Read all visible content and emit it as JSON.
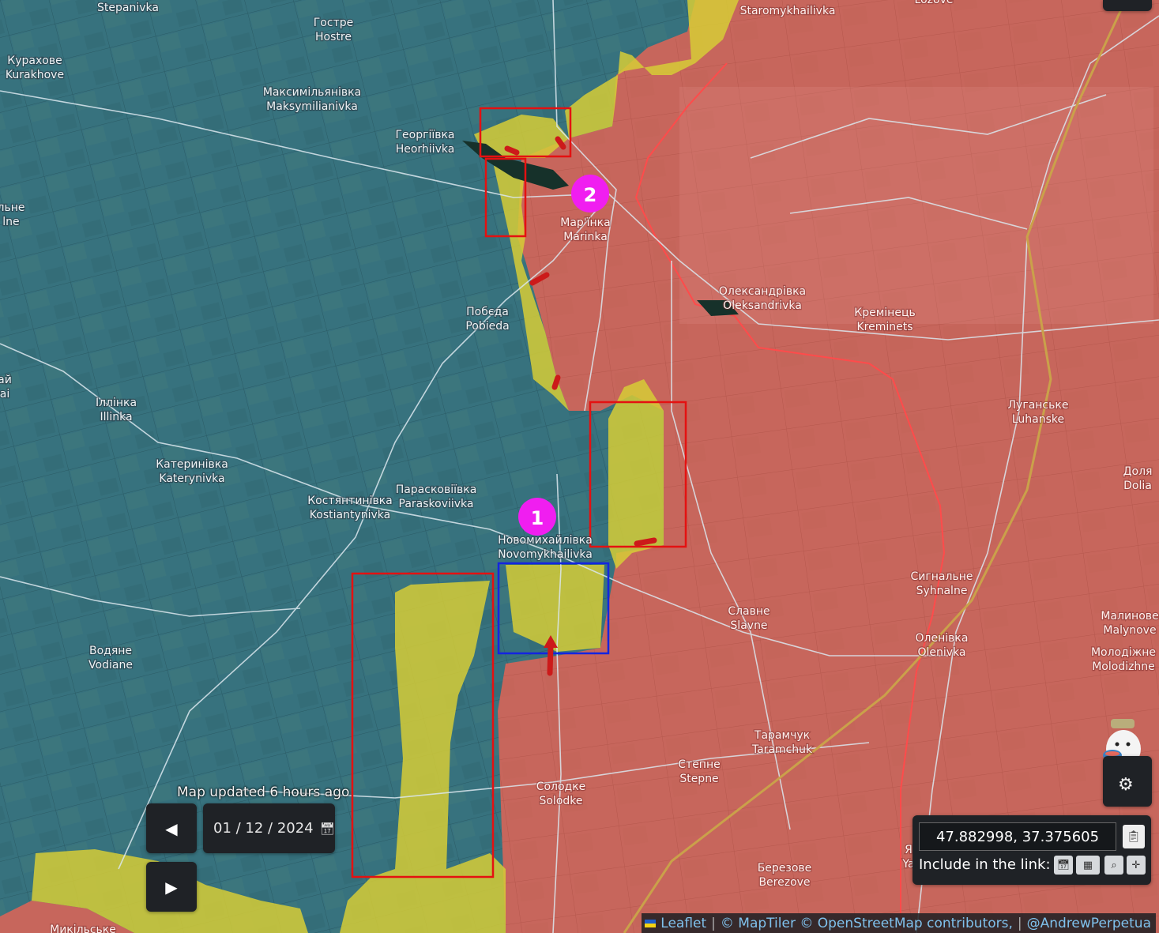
{
  "map": {
    "cities": [
      {
        "id": "stepanivka",
        "lines": [
          "Stepanivka"
        ]
      },
      {
        "id": "hostre",
        "lines": [
          "Гостре",
          "Hostre"
        ]
      },
      {
        "id": "kurakhove",
        "lines": [
          "Курахове",
          "Kurakhove"
        ]
      },
      {
        "id": "maksymilianivka",
        "lines": [
          "Максимільянівка",
          "Maksymilianivka"
        ]
      },
      {
        "id": "heorhiivka",
        "lines": [
          "Георгіївка",
          "Heorhiivka"
        ]
      },
      {
        "id": "marinka",
        "lines": [
          "Мар'їнка",
          "Marinka"
        ]
      },
      {
        "id": "pobieda",
        "lines": [
          "Побєда",
          "Pobieda"
        ]
      },
      {
        "id": "oleksandrivka",
        "lines": [
          "Олександрівка",
          "Oleksandrivka"
        ]
      },
      {
        "id": "kreminets",
        "lines": [
          "Кремінець",
          "Kreminets"
        ]
      },
      {
        "id": "illinka",
        "lines": [
          "Іллінка",
          "Illinka"
        ]
      },
      {
        "id": "katerynivka",
        "lines": [
          "Катеринівка",
          "Katerynivka"
        ]
      },
      {
        "id": "paraskoviivka",
        "lines": [
          "Парасковіївка",
          "Paraskoviivka"
        ]
      },
      {
        "id": "kostiantynivka",
        "lines": [
          "Костянтинівка",
          "Kostiantynivka"
        ]
      },
      {
        "id": "novomykhailivka",
        "lines": [
          "Новомихайлівка",
          "Novomykhailivka"
        ]
      },
      {
        "id": "luhanske",
        "lines": [
          "Луганське",
          "Luhanske"
        ]
      },
      {
        "id": "dolia",
        "lines": [
          "Доля",
          "Dolia"
        ]
      },
      {
        "id": "syhnalne",
        "lines": [
          "Сигнальне",
          "Syhnalne"
        ]
      },
      {
        "id": "slavne",
        "lines": [
          "Славне",
          "Slavne"
        ]
      },
      {
        "id": "vodiane",
        "lines": [
          "Водяне",
          "Vodiane"
        ]
      },
      {
        "id": "olenivka",
        "lines": [
          "Оленівка",
          "Olenivka"
        ]
      },
      {
        "id": "malynove",
        "lines": [
          "Малинове",
          "Malynove"
        ]
      },
      {
        "id": "molodizhne",
        "lines": [
          "Молодіжне",
          "Molodizhne"
        ]
      },
      {
        "id": "taramchuk",
        "lines": [
          "Тарамчук",
          "Taramchuk"
        ]
      },
      {
        "id": "stepne",
        "lines": [
          "Степне",
          "Stepne"
        ]
      },
      {
        "id": "solodke",
        "lines": [
          "Солодке",
          "Solodke"
        ]
      },
      {
        "id": "berezove",
        "lines": [
          "Березове",
          "Berezove"
        ]
      },
      {
        "id": "starmykhailivka",
        "lines": [
          "Staromykhailivka"
        ]
      },
      {
        "id": "lozove",
        "lines": [
          "Lozove"
        ]
      },
      {
        "id": "edge-ne",
        "lines": [
          "льне",
          "lne"
        ]
      },
      {
        "id": "edge-ai",
        "lines": [
          "ай",
          "ai"
        ]
      },
      {
        "id": "edge-ya",
        "lines": [
          "Я",
          "Ya"
        ]
      },
      {
        "id": "edge-myk",
        "lines": [
          "Микільське"
        ]
      }
    ],
    "markers": [
      {
        "id": "marker-1",
        "label": "1",
        "color": "#f01ef0"
      },
      {
        "id": "marker-2",
        "label": "2",
        "color": "#f01ef0"
      }
    ],
    "colors": {
      "ukraine_held": "#3a7a86",
      "russia_held": "#c5645a",
      "contested": "#d8cf3a",
      "frontline": "#ff4a4a",
      "highlight_red": "#e41111",
      "highlight_blue": "#1424e0",
      "attack_arrow": "#cc1a1a"
    }
  },
  "timeline": {
    "updated_text": "Map updated 6 hours ago",
    "date_value": "01 / 12 / 2024",
    "prev_icon": "◀",
    "next_icon": "▶",
    "calendar_icon": "calendar-icon"
  },
  "coords": {
    "value": "47.882998, 37.375605",
    "include_label": "Include in the link:",
    "copy_icon": "clipboard-icon",
    "include_options": [
      "calendar-icon",
      "map-icon",
      "zoom-icon",
      "crosshair-icon"
    ]
  },
  "attribution": {
    "leaflet": "Leaflet",
    "maptiler": "© MapTiler",
    "osm": "© OpenStreetMap contributors,",
    "author": "@AndrewPerpetua"
  }
}
